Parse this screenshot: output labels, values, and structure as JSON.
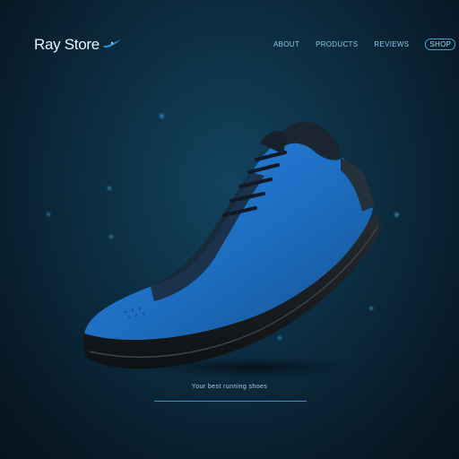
{
  "brand": {
    "name": "Ray Store"
  },
  "nav": {
    "items": [
      "ABOUT",
      "PRODUCTS",
      "REVIEWS",
      "SHOP"
    ]
  },
  "footer": {
    "tagline": "Your best running shoes"
  },
  "colors": {
    "accent": "#1f6fc7",
    "background": "#0c2c40",
    "sole": "#15191d"
  }
}
